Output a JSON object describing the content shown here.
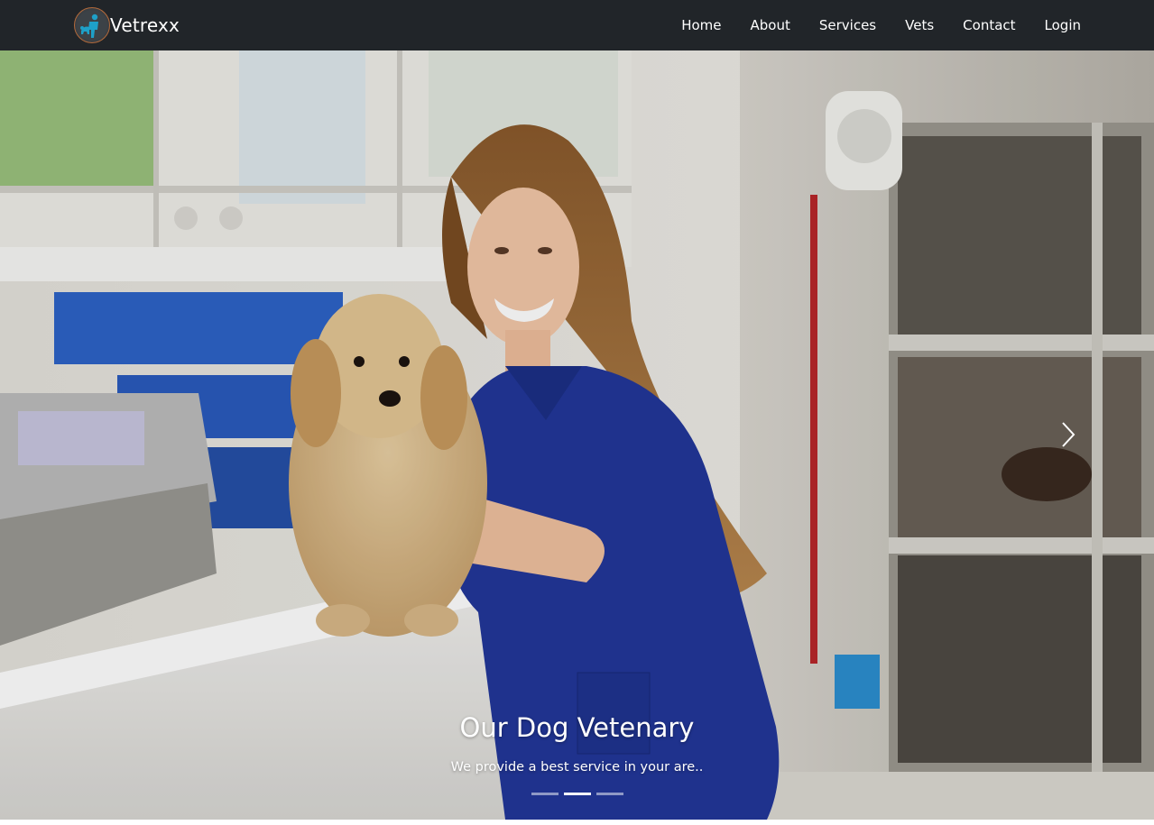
{
  "navbar": {
    "brand": {
      "name": "Vetrexx",
      "logo_icon": "vet-pet-logo-icon"
    },
    "links": [
      {
        "label": "Home"
      },
      {
        "label": "About"
      },
      {
        "label": "Services"
      },
      {
        "label": "Vets"
      },
      {
        "label": "Contact"
      },
      {
        "label": "Login"
      }
    ],
    "background": "#212529"
  },
  "carousel": {
    "slide": {
      "image": "vet-with-puppy-photo",
      "title": "Our Dog Vetenary",
      "text": "We provide a best service in your are.."
    },
    "next_icon": "chevron-right-icon",
    "indicators": {
      "count": 3,
      "active_index": 1
    }
  }
}
